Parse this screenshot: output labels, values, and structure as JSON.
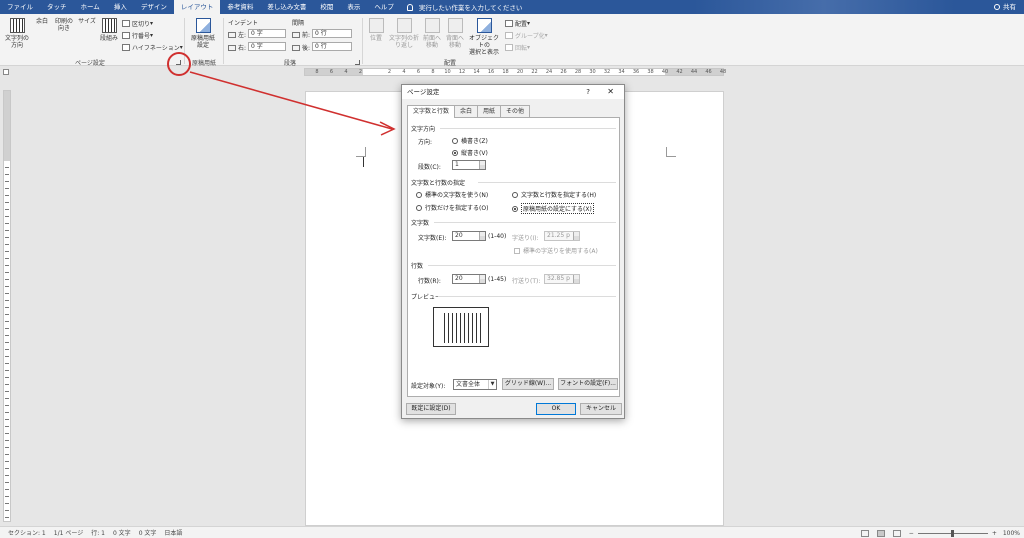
{
  "ribbon_tabs": [
    {
      "label": "ファイル",
      "active": false
    },
    {
      "label": "タッチ",
      "active": false
    },
    {
      "label": "ホーム",
      "active": false
    },
    {
      "label": "挿入",
      "active": false
    },
    {
      "label": "デザイン",
      "active": false
    },
    {
      "label": "レイアウト",
      "active": true
    },
    {
      "label": "参考資料",
      "active": false
    },
    {
      "label": "差し込み文書",
      "active": false
    },
    {
      "label": "校閲",
      "active": false
    },
    {
      "label": "表示",
      "active": false
    },
    {
      "label": "ヘルプ",
      "active": false
    }
  ],
  "tell_me": "実行したい作業を入力してください",
  "share": "共有",
  "page_setup_group": {
    "text_direction": "文字列の\n方向",
    "margins": "余白",
    "orientation": "印刷の\n向き",
    "size": "サイズ",
    "columns": "段組み",
    "breaks": "区切り",
    "line_numbers": "行番号",
    "hyphenation": "ハイフネーション",
    "group_name": "ページ設定"
  },
  "genko_group": {
    "button": "原稿用紙\n設定",
    "group_name": "原稿用紙"
  },
  "paragraph_group": {
    "indent_header": "インデント",
    "spacing_header": "間隔",
    "left_label": "左:",
    "left_value": "0 字",
    "right_label": "右:",
    "right_value": "0 字",
    "before_label": "前:",
    "before_value": "0 行",
    "after_label": "後:",
    "after_value": "0 行",
    "group_name": "段落"
  },
  "arrange_group": {
    "position": "位置",
    "wrap_text": "文字列の折\nり返し",
    "bring_forward": "前面へ\n移動",
    "send_backward": "背面へ\n移動",
    "selection_pane": "オブジェクトの\n選択と表示",
    "align": "配置",
    "group": "グループ化",
    "rotate": "回転",
    "group_name": "配置"
  },
  "ruler_numbers": [
    "8",
    "6",
    "4",
    "2",
    "",
    "2",
    "4",
    "6",
    "8",
    "10",
    "12",
    "14",
    "16",
    "18",
    "20",
    "22",
    "24",
    "26",
    "28",
    "30",
    "32",
    "34",
    "36",
    "38",
    "40",
    "42",
    "44",
    "46",
    "48"
  ],
  "dialog": {
    "title": "ページ設定",
    "help": "?",
    "close": "✕",
    "tabs": [
      {
        "label": "文字数と行数",
        "active": true
      },
      {
        "label": "余白",
        "active": false
      },
      {
        "label": "用紙",
        "active": false
      },
      {
        "label": "その他",
        "active": false
      }
    ],
    "text_direction_section": "文字方向",
    "direction_label": "方向:",
    "horizontal": "横書き(Z)",
    "vertical": "縦書き(V)",
    "columns_label": "段数(C):",
    "columns_value": "1",
    "grid_section": "文字数と行数の指定",
    "grid_opt_standard": "標準の文字数を使う(N)",
    "grid_opt_lines_only": "行数だけを指定する(O)",
    "grid_opt_chars_lines": "文字数と行数を指定する(H)",
    "grid_opt_genko": "原稿用紙の設定にする(X)",
    "chars_section": "文字数",
    "chars_label": "文字数(E):",
    "chars_value": "20",
    "chars_range": "(1-40)",
    "char_pitch_label": "字送り(I):",
    "char_pitch_value": "21.25 p",
    "use_default_pitch": "標準の字送りを使用する(A)",
    "lines_section": "行数",
    "lines_label": "行数(R):",
    "lines_value": "20",
    "lines_range": "(1-45)",
    "line_pitch_label": "行送り(T):",
    "line_pitch_value": "32.85 p",
    "preview_section": "プレビュー",
    "apply_to_label": "設定対象(Y):",
    "apply_to_value": "文書全体",
    "grid_button": "グリッド線(W)...",
    "font_button": "フォントの設定(F)...",
    "default_button": "既定に設定(D)",
    "ok_button": "OK",
    "cancel_button": "キャンセル"
  },
  "status_bar": {
    "section": "セクション: 1",
    "page": "1/1 ページ",
    "line": "行: 1",
    "chars1": "0 文字",
    "chars2": "0 文字",
    "language": "日本語",
    "zoom": "100%"
  },
  "colors": {
    "ribbon_blue": "#2b579a",
    "annotation_red": "#d0302f",
    "ok_border": "#0078d7"
  }
}
